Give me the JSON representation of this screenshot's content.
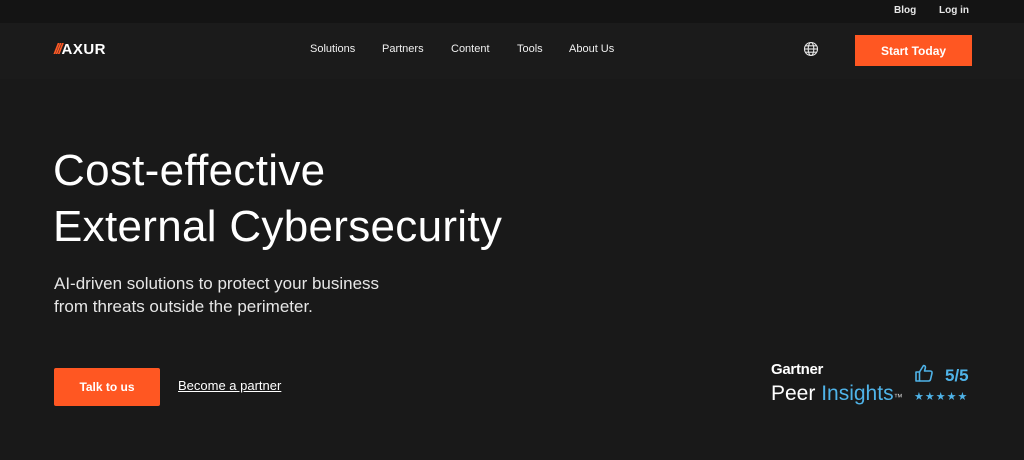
{
  "topbar": {
    "blog": "Blog",
    "login": "Log in"
  },
  "nav": {
    "logo_slashes": "///",
    "logo_text": "AXUR",
    "items": [
      "Solutions",
      "Partners",
      "Content",
      "Tools",
      "About Us"
    ],
    "globe_icon": "globe-icon",
    "cta": "Start Today"
  },
  "hero": {
    "title_line1": "Cost-effective",
    "title_line2": "External Cybersecurity",
    "subtitle_line1": "AI-driven solutions to protect your business",
    "subtitle_line2": "from threats outside the perimeter.",
    "primary_cta": "Talk to us",
    "secondary_cta": "Become a partner"
  },
  "review": {
    "brand": "Gartner",
    "peer": "Peer",
    "insights": "Insights",
    "tm": "™",
    "rating": "5/5",
    "stars": "★★★★★",
    "stars_count": 5,
    "thumb_icon": "thumbs-up-icon"
  },
  "colors": {
    "accent": "#ff5722",
    "background": "#191919",
    "review_blue": "#4fb3e8"
  }
}
